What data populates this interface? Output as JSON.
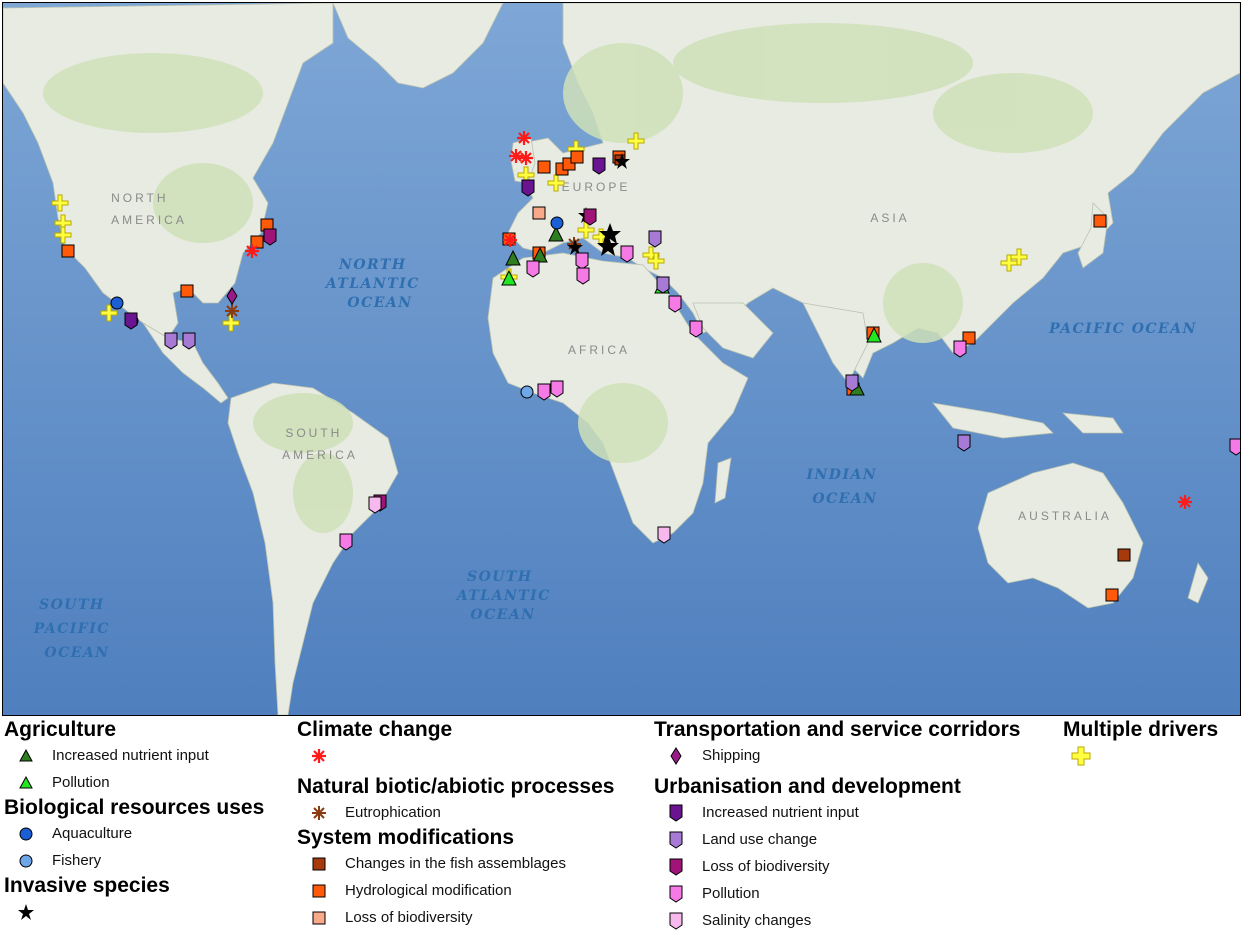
{
  "map": {
    "ocean_labels": [
      {
        "lines": [
          "NORTH",
          "ATLANTIC",
          "OCEAN"
        ]
      },
      {
        "lines": [
          "PACIFIC OCEAN"
        ]
      },
      {
        "lines": [
          "INDIAN",
          "OCEAN"
        ]
      },
      {
        "lines": [
          "SOUTH",
          "ATLANTIC",
          "OCEAN"
        ]
      },
      {
        "lines": [
          "SOUTH",
          "PACIFIC",
          "OCEAN"
        ]
      }
    ],
    "continent_labels": [
      {
        "lines": [
          "NORTH",
          "AMERICA"
        ]
      },
      {
        "lines": [
          "SOUTH",
          "AMERICA"
        ]
      },
      {
        "lines": [
          "EUROPE"
        ]
      },
      {
        "lines": [
          "ASIA"
        ]
      },
      {
        "lines": [
          "AFRICA"
        ]
      },
      {
        "lines": [
          "AUSTRALIA"
        ]
      }
    ]
  },
  "colors": {
    "ocean": "#5f8fc8",
    "land": "#e9ece4",
    "vegetation": "#cfe0b8",
    "agri_nutrient": "#2e7d1e",
    "agri_pollution": "#22e622",
    "aquaculture": "#1a5fd6",
    "fishery": "#6fa8e8",
    "invasive": "#000000",
    "climate": "#ff1a1a",
    "eutrophication": "#8a3b12",
    "fish_assemblage": "#a63a0c",
    "hydro": "#ff5a0a",
    "sys_biodiv": "#f7a98a",
    "shipping": "#9b1a8a",
    "multiple": "#ffff40",
    "urb_nutrient": "#6a1491",
    "urb_landuse": "#a77ad6",
    "urb_biodiv": "#a0147a",
    "urb_pollution": "#f57ae6",
    "urb_salinity": "#f7b8ee"
  },
  "legend": {
    "agriculture": {
      "title": "Agriculture",
      "items": [
        "Increased nutrient input",
        "Pollution"
      ]
    },
    "biological": {
      "title": "Biological resources uses",
      "items": [
        "Aquaculture",
        "Fishery"
      ]
    },
    "invasive": {
      "title": "Invasive species"
    },
    "climate": {
      "title": "Climate change"
    },
    "natural": {
      "title": "Natural biotic/abiotic processes",
      "items": [
        "Eutrophication"
      ]
    },
    "system": {
      "title": "System modifications",
      "items": [
        "Changes in the fish assemblages",
        "Hydrological modification",
        "Loss of biodiversity"
      ]
    },
    "transport": {
      "title": "Transportation and service corridors",
      "items": [
        "Shipping"
      ]
    },
    "urban": {
      "title": "Urbanisation and development",
      "items": [
        "Increased nutrient input",
        "Land use change",
        "Loss of biodiversity",
        "Pollution",
        "Salinity changes"
      ]
    },
    "multiple": {
      "title": "Multiple drivers"
    }
  }
}
